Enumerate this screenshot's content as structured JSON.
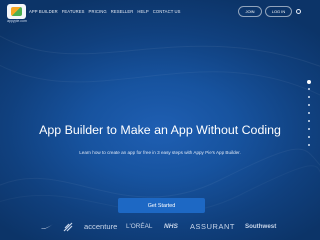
{
  "brand": {
    "logo_text": "appypie.com"
  },
  "nav": {
    "items": [
      "APP BUILDER",
      "FEATURES",
      "PRICING",
      "RESELLER",
      "HELP",
      "CONTACT US"
    ],
    "join_label": "JOIN",
    "login_label": "LOG IN"
  },
  "slider": {
    "total": 9,
    "active_index": 0
  },
  "hero": {
    "title": "App Builder to Make an App Without Coding",
    "subtitle": "Learn how to create an app for free in 3 easy steps with Appy Pie's App Builder.",
    "cta_label": "Get Started"
  },
  "clients": [
    "accenture",
    "L'ORÉAL",
    "NHS",
    "ASSURANT",
    "Southwest"
  ],
  "colors": {
    "accent": "#1d68c4",
    "background": "#10407e"
  }
}
